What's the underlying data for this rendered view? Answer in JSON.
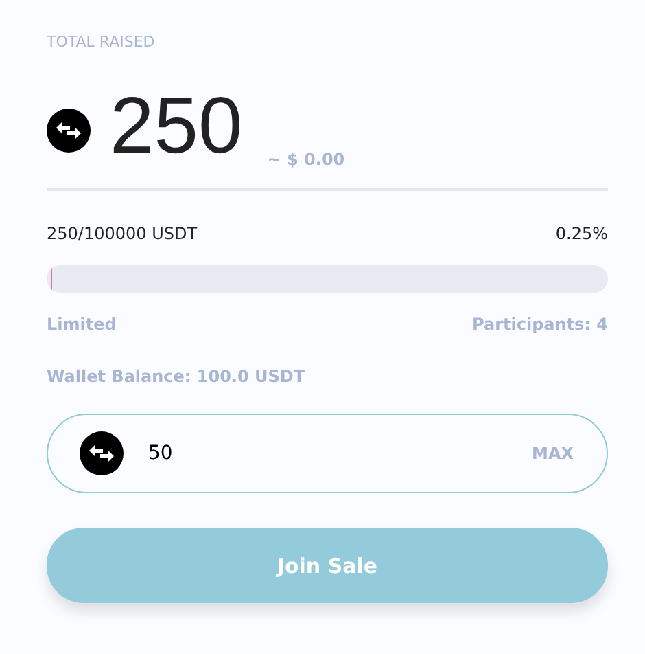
{
  "total_label": "TOTAL RAISED",
  "total_amount": "250",
  "total_usd": "~ $ 0.00",
  "progress": {
    "amount": "250/100000 USDT",
    "percent": "0.25%",
    "level": 0.0025
  },
  "limit_label": "Limited",
  "participants": "Participants: 4",
  "wallet_balance": "Wallet Balance: 100.0 USDT",
  "amount_field": {
    "value": "50",
    "max_label": "MAX"
  },
  "join_button": "Join Sale"
}
